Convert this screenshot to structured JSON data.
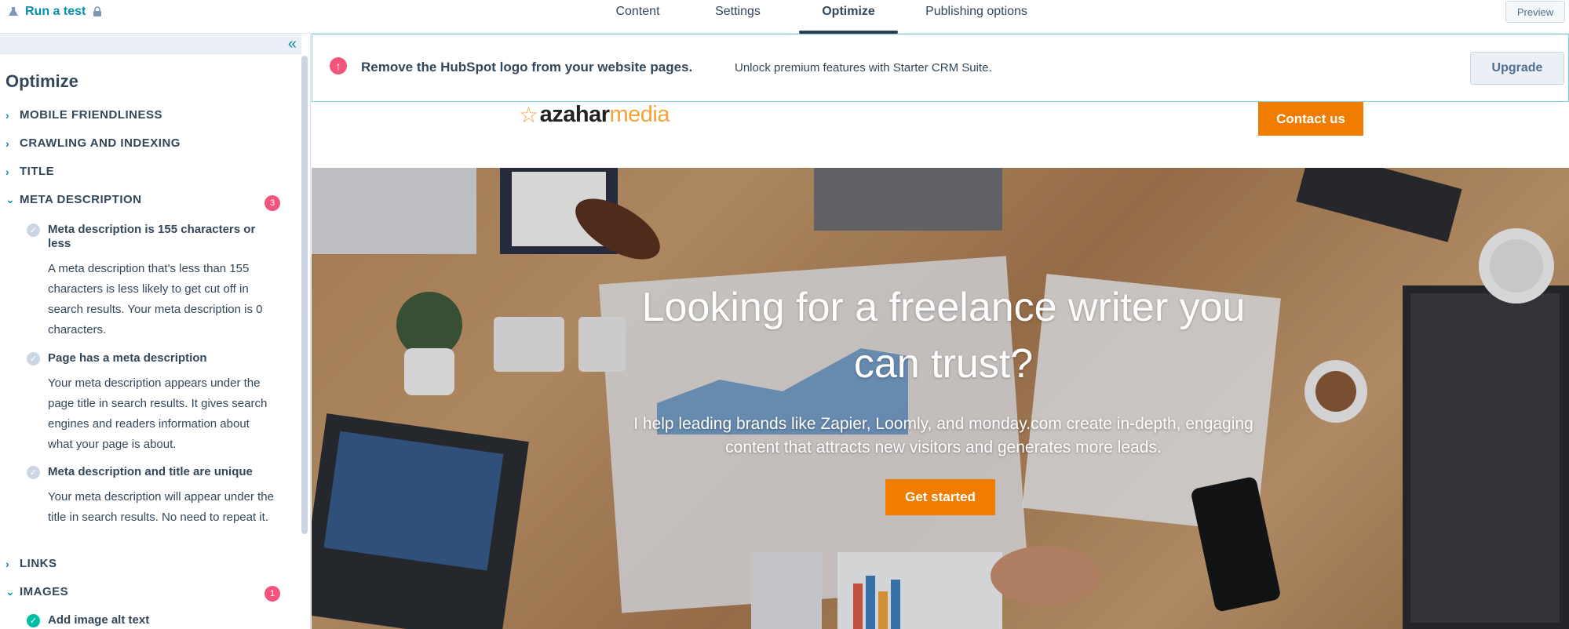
{
  "topbar": {
    "run_test_label": "Run a test",
    "tabs": [
      {
        "label": "Content"
      },
      {
        "label": "Settings"
      },
      {
        "label": "Optimize"
      },
      {
        "label": "Publishing options"
      }
    ],
    "preview_label": "Preview"
  },
  "sidebar": {
    "title": "Optimize",
    "sections": [
      {
        "label": "MOBILE FRIENDLINESS"
      },
      {
        "label": "CRAWLING AND INDEXING"
      },
      {
        "label": "TITLE"
      },
      {
        "label": "META DESCRIPTION",
        "badge": "3"
      },
      {
        "label": "LINKS"
      },
      {
        "label": "IMAGES",
        "badge": "1"
      }
    ],
    "meta_checks": [
      {
        "title": "Meta description is 155 characters or less",
        "desc": "A meta description that's less than 155 characters is less likely to get cut off in search results. Your meta description is 0 characters."
      },
      {
        "title": "Page has a meta description",
        "desc": "Your meta description appears under the page title in search results. It gives search engines and readers information about what your page is about."
      },
      {
        "title": "Meta description and title are unique",
        "desc": "Your meta description will appear under the title in search results. No need to repeat it."
      }
    ],
    "image_checks": [
      {
        "title": "Add image alt text"
      }
    ]
  },
  "banner": {
    "title": "Remove the HubSpot logo from your website pages.",
    "text": "Unlock premium features with Starter CRM Suite.",
    "upgrade_label": "Upgrade"
  },
  "site": {
    "logo_azahar": "azahar",
    "logo_media": "media",
    "contact_label": "Contact us",
    "hero_title": "Looking for a freelance writer you can trust?",
    "hero_subtitle": "I help leading brands like Zapier, Loomly, and monday.com create in-depth, engaging content that attracts new visitors and generates more leads.",
    "cta_label": "Get started"
  },
  "colors": {
    "accent": "#0091ae",
    "cta": "#f07c00",
    "badge": "#f2547d",
    "text": "#33475b"
  }
}
